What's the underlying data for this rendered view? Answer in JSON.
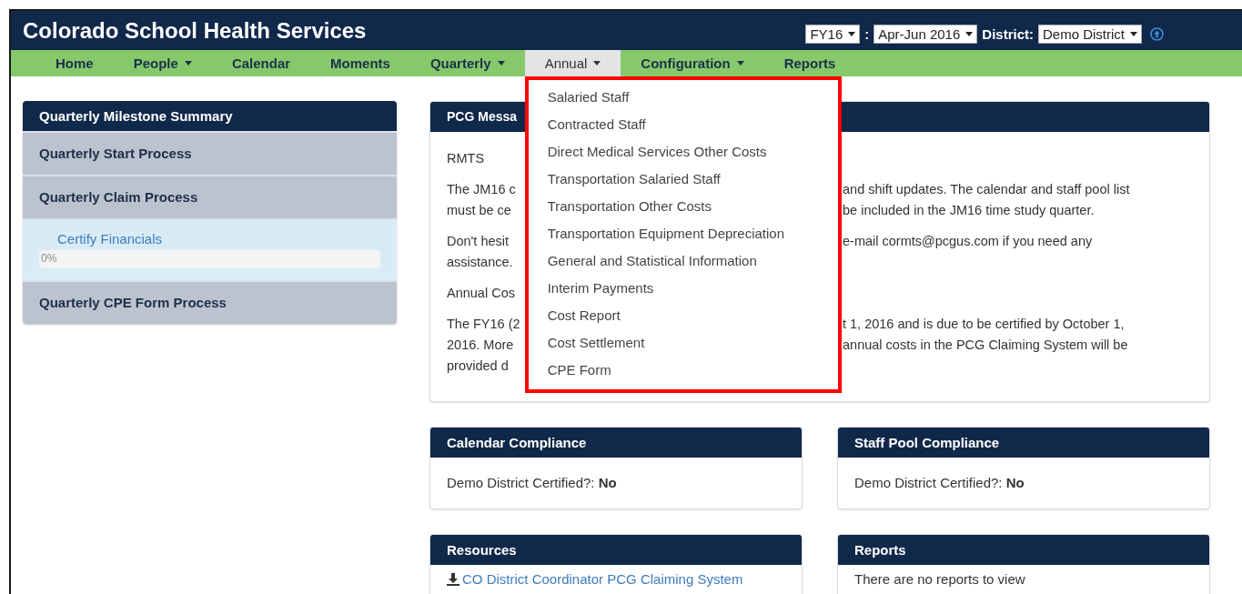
{
  "header": {
    "title": "Colorado School Health Services",
    "fiscal_year": "FY16",
    "separator": ":",
    "quarter": "Apr-Jun 2016",
    "district_label": "District:",
    "district": "Demo District"
  },
  "nav": [
    {
      "label": "Home",
      "dropdown": false,
      "selected": false
    },
    {
      "label": "People",
      "dropdown": true,
      "selected": false
    },
    {
      "label": "Calendar",
      "dropdown": false,
      "selected": false
    },
    {
      "label": "Moments",
      "dropdown": false,
      "selected": false
    },
    {
      "label": "Quarterly",
      "dropdown": true,
      "selected": false
    },
    {
      "label": "Annual",
      "dropdown": true,
      "selected": true
    },
    {
      "label": "Configuration",
      "dropdown": true,
      "selected": false
    },
    {
      "label": "Reports",
      "dropdown": false,
      "selected": false
    }
  ],
  "annual_menu": [
    "Salaried Staff",
    "Contracted Staff",
    "Direct Medical Services Other Costs",
    "Transportation Salaried Staff",
    "Transportation Other Costs",
    "Transportation Equipment Depreciation",
    "General and Statistical Information",
    "Interim Payments",
    "Cost Report",
    "Cost Settlement",
    "CPE Form"
  ],
  "milestones": {
    "title": "Quarterly Milestone Summary",
    "sections": [
      {
        "title": "Quarterly Start Process"
      },
      {
        "title": "Quarterly Claim Process",
        "tasks": [
          {
            "label": "Certify Financials",
            "progress_label": "0%",
            "level": 0
          }
        ]
      },
      {
        "title": "Quarterly CPE Form Process"
      }
    ]
  },
  "messages": {
    "title": "PCG Messa",
    "paragraphs": [
      [
        {
          "left": "RMTS"
        }
      ],
      [
        {
          "left": "The JM16 c",
          "right": "and shift updates. The calendar and staff pool list"
        },
        {
          "left": "must be ce",
          "right": "be included in the JM16 time study quarter."
        }
      ],
      [
        {
          "left": "Don't hesit",
          "right": "e-mail cormts@pcgus.com if you need any"
        },
        {
          "left": "assistance."
        }
      ],
      [
        {
          "left": "Annual Cos"
        }
      ],
      [
        {
          "left": "The FY16 (2",
          "right": "t 1, 2016 and is due to be certified by October 1,"
        },
        {
          "left": "2016. More",
          "right": "annual costs in the PCG Claiming System will be"
        },
        {
          "left": "provided d"
        }
      ]
    ]
  },
  "compliance": [
    {
      "title": "Calendar Compliance",
      "label": "Demo District Certified?:",
      "value": "No"
    },
    {
      "title": "Staff Pool Compliance",
      "label": "Demo District Certified?:",
      "value": "No"
    }
  ],
  "resources": {
    "title": "Resources",
    "items": [
      "CO District Coordinator PCG Claiming System"
    ]
  },
  "reports": {
    "title": "Reports",
    "empty_text": "There are no reports to view"
  }
}
